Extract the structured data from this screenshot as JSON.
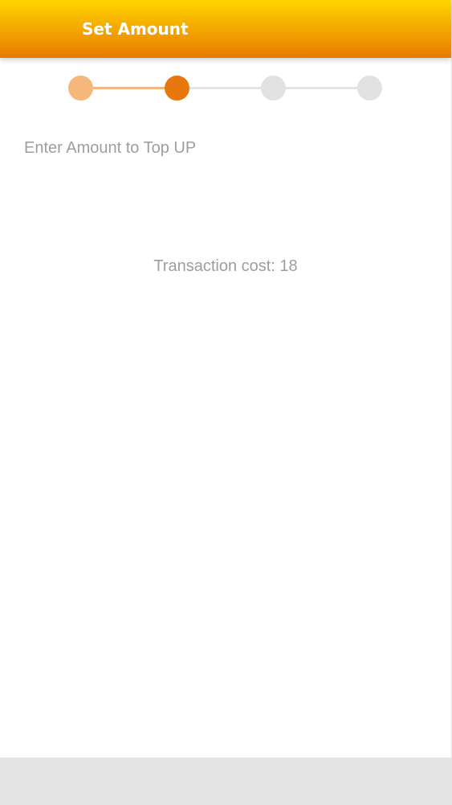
{
  "app_bar": {
    "title": "Set Amount"
  },
  "stepper": {
    "total_steps": 4,
    "current_step": 2,
    "colors": {
      "completed": "#f5b77a",
      "active": "#e8770d",
      "inactive": "#e2e2e2",
      "completed_line": "#f2b67e",
      "inactive_line": "#e4e4e4"
    }
  },
  "form": {
    "amount_prompt": "Enter Amount to Top UP",
    "amount_value": "",
    "transaction_cost": "Transaction cost: 18"
  },
  "theme": {
    "header_gradient_top": "#ffd500",
    "header_gradient_bottom": "#e97a00",
    "muted_text": "#9e9e9e",
    "bottom_bar": "#e3e3e3"
  }
}
